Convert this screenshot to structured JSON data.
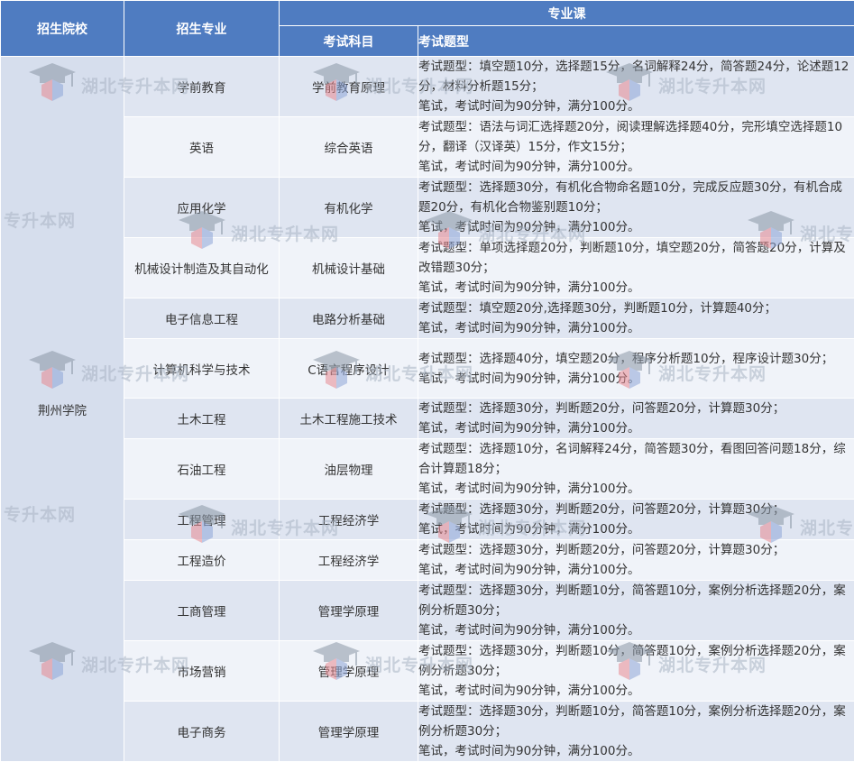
{
  "header": {
    "school": "招生院校",
    "major": "招生专业",
    "course_group": "专业课",
    "subject": "考试科目",
    "types": "考试题型"
  },
  "school_name": "荆州学院",
  "rows": [
    {
      "major": "学前教育",
      "subject": "学前教育原理",
      "lines": [
        "考试题型：填空题10分，选择题15分，名词解释24分，简答题24分，论述题12分，材料分析题15分；",
        "笔试，考试时间为90分钟，满分100分。"
      ]
    },
    {
      "major": "英语",
      "subject": "综合英语",
      "lines": [
        "考试题型：语法与词汇选择题20分，阅读理解选择题40分，完形填空选择题10分，翻译（汉译英）15分，作文15分；",
        "笔试，考试时间为90分钟，满分100分。"
      ]
    },
    {
      "major": "应用化学",
      "subject": "有机化学",
      "lines": [
        "考试题型：选择题30分，有机化合物命名题10分，完成反应题30分，有机合成题20分，有机化合物鉴别题10分；",
        "笔试，考试时间为90分钟，满分100分。"
      ]
    },
    {
      "major": "机械设计制造及其自动化",
      "subject": "机械设计基础",
      "lines": [
        "考试题型：单项选择题20分，判断题10分，填空题20分，简答题20分，计算及改错题30分；",
        "笔试，考试时间为90分钟，满分100分。"
      ]
    },
    {
      "major": "电子信息工程",
      "subject": "电路分析基础",
      "lines": [
        "考试题型：填空题20分,选择题30分，判断题10分，计算题40分；",
        "笔试，考试时间为90分钟，满分100分。"
      ]
    },
    {
      "major": "计算机科学与技术",
      "subject": "C语言程序设计",
      "lines": [
        "考试题型：选择题40分，填空题20分，程序分析题10分，程序设计题30分；",
        "笔试，考试时间为90分钟，满分100分。"
      ]
    },
    {
      "major": "土木工程",
      "subject": "土木工程施工技术",
      "lines": [
        "考试题型：选择题30分，判断题20分，问答题20分，计算题30分；",
        "笔试，考试时间为90分钟，满分100分。"
      ]
    },
    {
      "major": "石油工程",
      "subject": "油层物理",
      "lines": [
        "考试题型：选择题10分，名词解释24分，简答题30分，看图回答问题18分，综合计算题18分；",
        "笔试，考试时间为90分钟，满分100分。"
      ]
    },
    {
      "major": "工程管理",
      "subject": "工程经济学",
      "lines": [
        "考试题型：选择题30分，判断题20分，问答题20分，计算题30分；",
        "笔试，考试时间为90分钟，满分100分。"
      ]
    },
    {
      "major": "工程造价",
      "subject": "工程经济学",
      "lines": [
        "考试题型：选择题30分，判断题20分，问答题20分，计算题30分；",
        "笔试，考试时间为90分钟，满分100分。"
      ]
    },
    {
      "major": "工商管理",
      "subject": "管理学原理",
      "lines": [
        "考试题型：选择题30分，判断题10分，简答题10分，案例分析选择题20分，案例分析题30分；",
        "笔试，考试时间为90分钟，满分100分。"
      ]
    },
    {
      "major": "市场营销",
      "subject": "管理学原理",
      "lines": [
        "考试题型：选择题30分，判断题10分，简答题10分，案例分析选择题20分，案例分析题30分；",
        "笔试，考试时间为90分钟，满分100分。"
      ]
    },
    {
      "major": "电子商务",
      "subject": "管理学原理",
      "lines": [
        "考试题型：选择题30分，判断题10分，简答题10分，案例分析选择题20分，案例分析题30分；",
        "笔试，考试时间为90分钟，满分100分。"
      ]
    }
  ],
  "watermark": {
    "full": "湖北专升本网",
    "partial_left": "专升本网",
    "partial_right": "湖北专"
  }
}
